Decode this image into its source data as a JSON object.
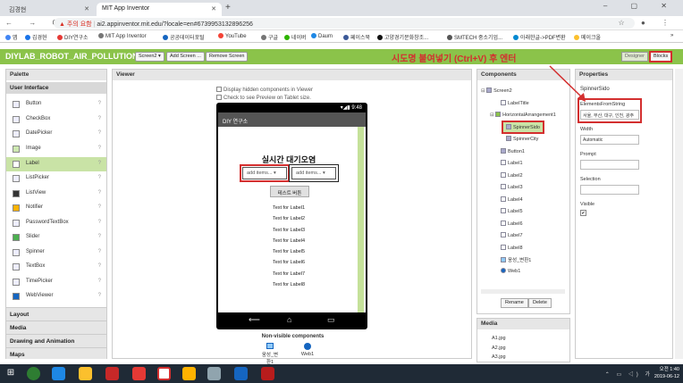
{
  "browser": {
    "tabs": [
      {
        "label": "김경현"
      },
      {
        "label": "MIT App Inventor"
      }
    ],
    "new_tab": "+",
    "window_controls": "–  ▢  ✕",
    "nav": "←  →  C",
    "security_warning": "▲ 주의 요함",
    "url": "ai2.appinventor.mit.edu/?locale=en#6739953132896256",
    "addr_icons": "☆  ●  ⋮",
    "bookmarks": [
      "앱",
      "김경현",
      "DIY연구소",
      "MIT App Inventor",
      "공공데이터포털",
      "YouTube",
      "구글",
      "네이버",
      "Daum",
      "페이스북",
      "고양경기문화창조...",
      "SMTECH 중소기업...",
      "아래한글->PDF변환",
      "메이크올"
    ],
    "bookmarks_more": "»"
  },
  "app": {
    "project_name": "DIYLAB_ROBOT_AIR_POLLUTION1",
    "screen_select": "Screen2 ▾",
    "add_screen": "Add Screen ...",
    "remove_screen": "Remove Screen",
    "hint": "시도명 붙여넣기 (Ctrl+V) 후 엔터",
    "designer": "Designer",
    "blocks": "Blocks"
  },
  "palette": {
    "title": "Palette",
    "section": "User Interface",
    "items": [
      {
        "label": "Button"
      },
      {
        "label": "CheckBox"
      },
      {
        "label": "DatePicker"
      },
      {
        "label": "Image"
      },
      {
        "label": "Label"
      },
      {
        "label": "ListPicker"
      },
      {
        "label": "ListView"
      },
      {
        "label": "Notifier"
      },
      {
        "label": "PasswordTextBox"
      },
      {
        "label": "Slider"
      },
      {
        "label": "Spinner"
      },
      {
        "label": "TextBox"
      },
      {
        "label": "TimePicker"
      },
      {
        "label": "WebViewer"
      }
    ],
    "help": "?",
    "categories": [
      "Layout",
      "Media",
      "Drawing and Animation",
      "Maps"
    ]
  },
  "viewer": {
    "title": "Viewer",
    "chk_hidden": "Display hidden components in Viewer",
    "chk_tablet": "Check to see Preview on Tablet size.",
    "status_time": "▾◢▮ 9:48",
    "app_title": "DIY 연구소",
    "heading": "실시간 대기오염",
    "spinner1": "add items...  ▾",
    "spinner2": "add items...  ▾",
    "test_button": "테스트 버튼",
    "labels": [
      "Text for Label1",
      "Text for Label2",
      "Text for Label3",
      "Text for Label4",
      "Text for Label5",
      "Text for Label6",
      "Text for Label7",
      "Text for Label8"
    ],
    "nav_back": "⟵",
    "nav_home": "⌂",
    "nav_recent": "▭",
    "nonvisible_title": "Non-visible components",
    "nonvisible": [
      {
        "label": "웅성_변환1"
      },
      {
        "label": "Web1"
      }
    ]
  },
  "components": {
    "title": "Components",
    "tree": [
      "Screen2",
      "LabelTitle",
      "HorizontalArrangement1",
      "SpinnerSido",
      "SpinnerCity",
      "Button1",
      "Label1",
      "Label2",
      "Label3",
      "Label4",
      "Label5",
      "Label6",
      "Label7",
      "Label8",
      "웅성_변환1",
      "Web1"
    ],
    "rename": "Rename",
    "delete": "Delete"
  },
  "media": {
    "title": "Media",
    "files": [
      "A1.jpg",
      "A2.jpg",
      "A3.jpg"
    ]
  },
  "properties": {
    "title": "Properties",
    "component": "SpinnerSido",
    "efs_label": "ElementsFromString",
    "efs_value": "서울, 부산, 대구, 인천, 광주",
    "width_label": "Width",
    "width_value": "Automatic",
    "prompt_label": "Prompt",
    "selection_label": "Selection",
    "visible_label": "Visible",
    "visible_value": "✔"
  },
  "taskbar": {
    "start": "⊞",
    "tray_icons": "⌃ ▭ ◁) 가",
    "time": "오전 1:40",
    "date": "2019-06-12"
  },
  "colors": {
    "accent": "#8bc34a",
    "highlight_red": "#d32f2f",
    "selected": "#c9e3a6"
  }
}
